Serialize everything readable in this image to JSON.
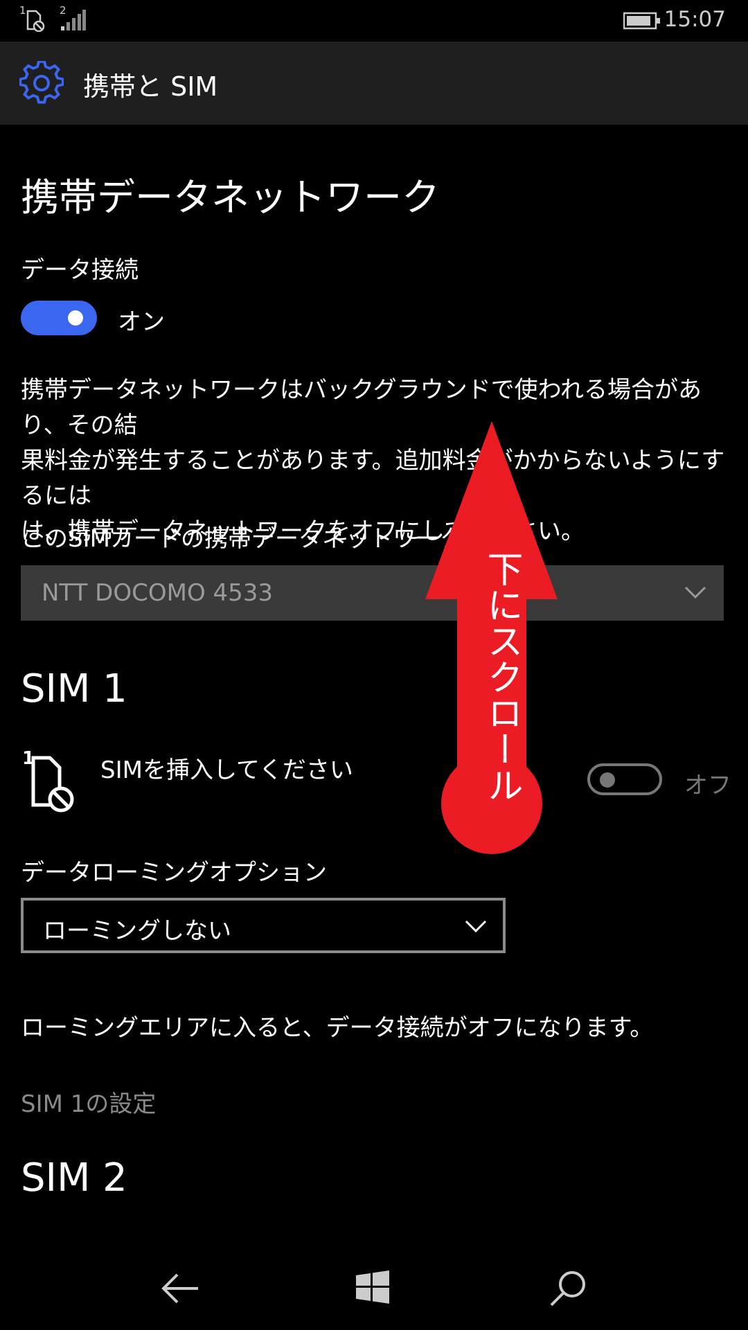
{
  "status_bar": {
    "sim1_number": "1",
    "sim2_number": "2",
    "time": "15:07"
  },
  "header": {
    "title": "携帯と SIM",
    "icon": "gear-icon",
    "accent_color": "#3b66ef"
  },
  "mobile_data": {
    "section_title": "携帯データネットワーク",
    "data_connection_label": "データ接続",
    "data_connection_state": "オン",
    "description_lines": [
      "携帯データネットワークはバックグラウンドで使われる場合があり、その結",
      "果料金が発生することがあります。追加料金がかからないようにするには",
      "は、携帯データネットワークをオフにしてください。"
    ],
    "sim_select_label": "このSIMカードの携帯データネットワークを使う",
    "sim_select_value": "NTT DOCOMO 4533"
  },
  "sim1": {
    "title": "SIM 1",
    "icon_number": "1",
    "insert_text": "SIMを挿入してください",
    "toggle_state": "オフ",
    "roaming_label": "データローミングオプション",
    "roaming_value": "ローミングしない",
    "roaming_note": "ローミングエリアに入ると、データ接続がオフになります。",
    "settings_link": "SIM 1の設定"
  },
  "sim2": {
    "title": "SIM 2"
  },
  "overlay": {
    "arrow_text": "下にスクロール",
    "arrow_color": "#ec1c24"
  },
  "nav_bar": {
    "icons": [
      "back-arrow-icon",
      "windows-start-icon",
      "search-icon"
    ]
  }
}
